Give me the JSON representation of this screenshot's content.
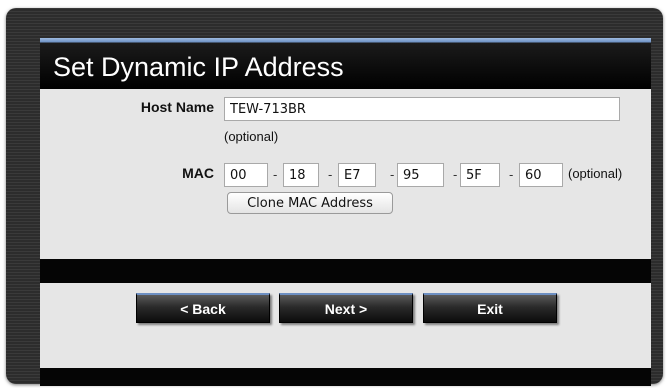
{
  "page": {
    "title": "Set Dynamic IP Address"
  },
  "form": {
    "host_name": {
      "label": "Host Name",
      "value": "TEW-713BR",
      "hint": "(optional)"
    },
    "mac": {
      "label": "MAC",
      "octets": [
        "00",
        "18",
        "E7",
        "95",
        "5F",
        "60"
      ],
      "separator": "-",
      "hint": "(optional)",
      "clone_label": "Clone MAC Address"
    }
  },
  "nav": {
    "back_label": "< Back",
    "next_label": "Next >",
    "exit_label": "Exit"
  },
  "colors": {
    "title_bar_accent": "#6f93c6",
    "content_bg": "#e6e6e6"
  }
}
